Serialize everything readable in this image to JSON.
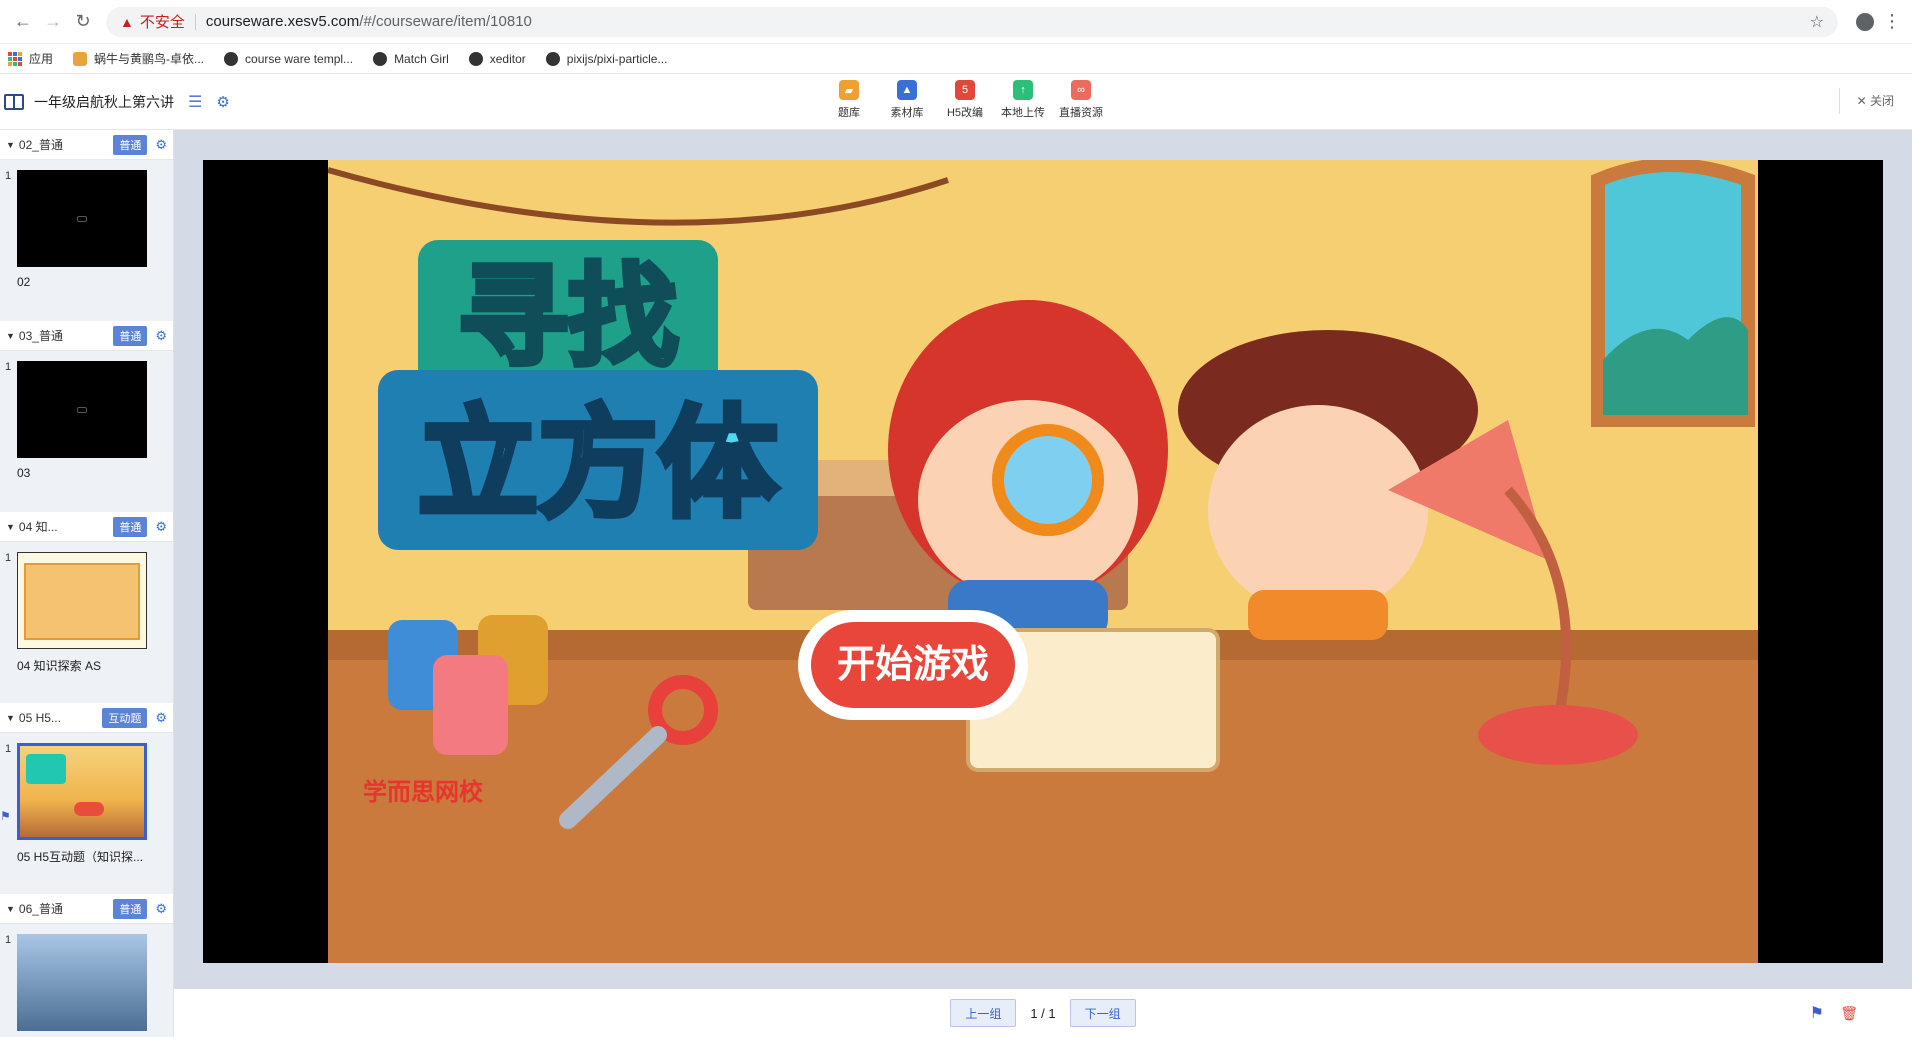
{
  "browser": {
    "insecure_label": "不安全",
    "url_host": "courseware.xesv5.com",
    "url_path": "/#/courseware/item/10810"
  },
  "bookmarks": [
    {
      "label": "应用"
    },
    {
      "label": "蜗牛与黄鹂鸟-卓依..."
    },
    {
      "label": "course ware templ..."
    },
    {
      "label": "Match Girl"
    },
    {
      "label": "xeditor"
    },
    {
      "label": "pixijs/pixi-particle..."
    }
  ],
  "header": {
    "course_title": "一年级启航秋上第六讲",
    "tools": [
      {
        "label": "题库",
        "color": "#f0a030"
      },
      {
        "label": "素材库",
        "color": "#3b6fd8"
      },
      {
        "label": "H5改编",
        "color": "#e2473a"
      },
      {
        "label": "本地上传",
        "color": "#2bbf7a"
      },
      {
        "label": "直播资源",
        "color": "#ec6b5e"
      }
    ],
    "close_label": "关闭"
  },
  "sidebar": {
    "groups": [
      {
        "name": "02_普通",
        "badge": "普通",
        "slide_num": "1",
        "slide_label": "02"
      },
      {
        "name": "03_普通",
        "badge": "普通",
        "slide_num": "1",
        "slide_label": "03"
      },
      {
        "name": "04 知...",
        "badge": "普通",
        "slide_num": "1",
        "slide_label": "04 知识探索 AS"
      },
      {
        "name": "05 H5...",
        "badge": "互动题",
        "slide_num": "1",
        "slide_label": "05 H5互动题（知识探..."
      },
      {
        "name": "06_普通",
        "badge": "普通",
        "slide_num": "1",
        "slide_label": ""
      }
    ]
  },
  "stage": {
    "title_line1": "寻找",
    "title_line2": "立方体",
    "start_button": "开始游戏",
    "school_logo": "学而思网校"
  },
  "pager": {
    "prev": "上一组",
    "page": "1 / 1",
    "next": "下一组"
  }
}
